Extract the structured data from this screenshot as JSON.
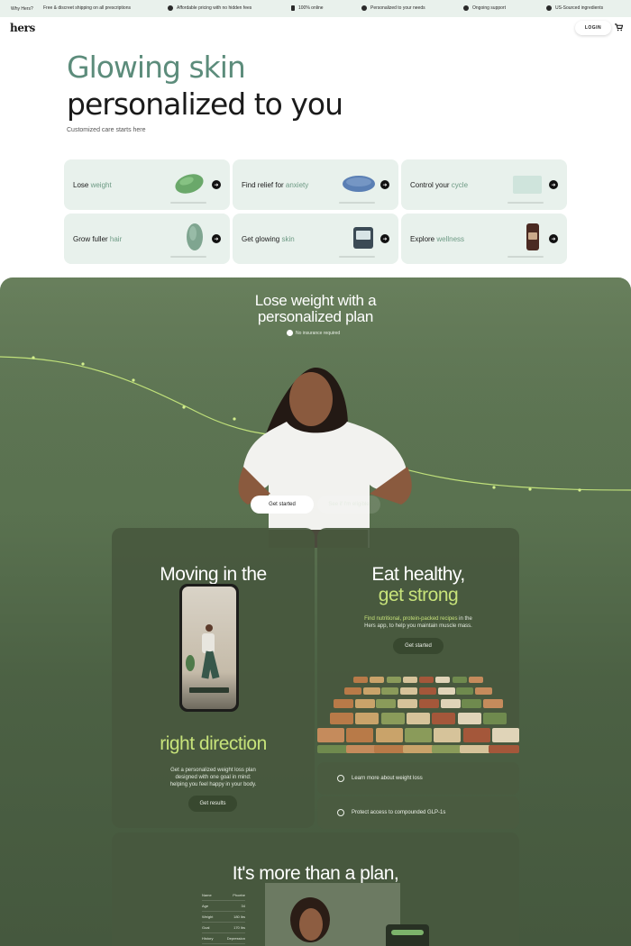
{
  "top_strip": {
    "why": "Why Hers?",
    "items": [
      "Free & discreet shipping on all prescriptions",
      "Affordable pricing with no hidden fees",
      "100% online",
      "Personalized to your needs",
      "Ongoing support",
      "US-Sourced ingredients"
    ]
  },
  "header": {
    "logo": "hers",
    "login": "LOGIN"
  },
  "hero": {
    "title_line1": "Glowing skin",
    "title_line2": "personalized to you",
    "subtitle": "Customized care starts here"
  },
  "categories": [
    {
      "prefix": "Lose ",
      "accent": "weight",
      "icon": "pill-icon"
    },
    {
      "prefix": "Find relief for ",
      "accent": "anxiety",
      "icon": "tablet-icon"
    },
    {
      "prefix": "Control your ",
      "accent": "cycle",
      "icon": "pack-icon"
    },
    {
      "prefix": "Grow fuller ",
      "accent": "hair",
      "icon": "leaf-pill-icon"
    },
    {
      "prefix": "Get glowing ",
      "accent": "skin",
      "icon": "jar-icon"
    },
    {
      "prefix": "Explore ",
      "accent": "wellness",
      "icon": "bottle-icon"
    }
  ],
  "weight_section": {
    "title_line1": "Lose weight with a",
    "title_line2": "personalized plan",
    "no_insurance": "No insurance required",
    "get_started": "Get started",
    "eligible": "See if I'm eligible"
  },
  "moving_panel": {
    "title_top": "Moving in the",
    "title_bottom": "right direction",
    "desc_line1": "Get a personalized weight loss plan",
    "desc_line2": "designed with one goal in mind:",
    "desc_line3": "helping you feel happy in your body.",
    "button": "Get results"
  },
  "eat_panel": {
    "title_line1": "Eat healthy,",
    "title_line2": "get strong",
    "desc_line1_accent": "Find nutritional, protein-packed recipes",
    "desc_line1_rest": " in the",
    "desc_line2": "Hers app, to help you maintain muscle mass.",
    "button": "Get started"
  },
  "links": [
    {
      "label": "Learn more about weight loss",
      "icon": "info-icon"
    },
    {
      "label": "Protect access to compounded GLP-1s",
      "icon": "shield-slash-icon"
    }
  ],
  "plan_panel": {
    "title": "It's more than a plan,",
    "stats": [
      {
        "k": "Name",
        "v": "Phoebe"
      },
      {
        "k": "Age",
        "v": "34"
      },
      {
        "k": "Weight",
        "v": "180 lbs"
      },
      {
        "k": "Goal",
        "v": "170 lbs"
      },
      {
        "k": "History",
        "v": "Depression"
      }
    ]
  },
  "colors": {
    "brand_green": "#5c8c7b",
    "lime": "#c7e37a",
    "card_bg": "#e8f1ec",
    "section_green": "#5a7250"
  }
}
